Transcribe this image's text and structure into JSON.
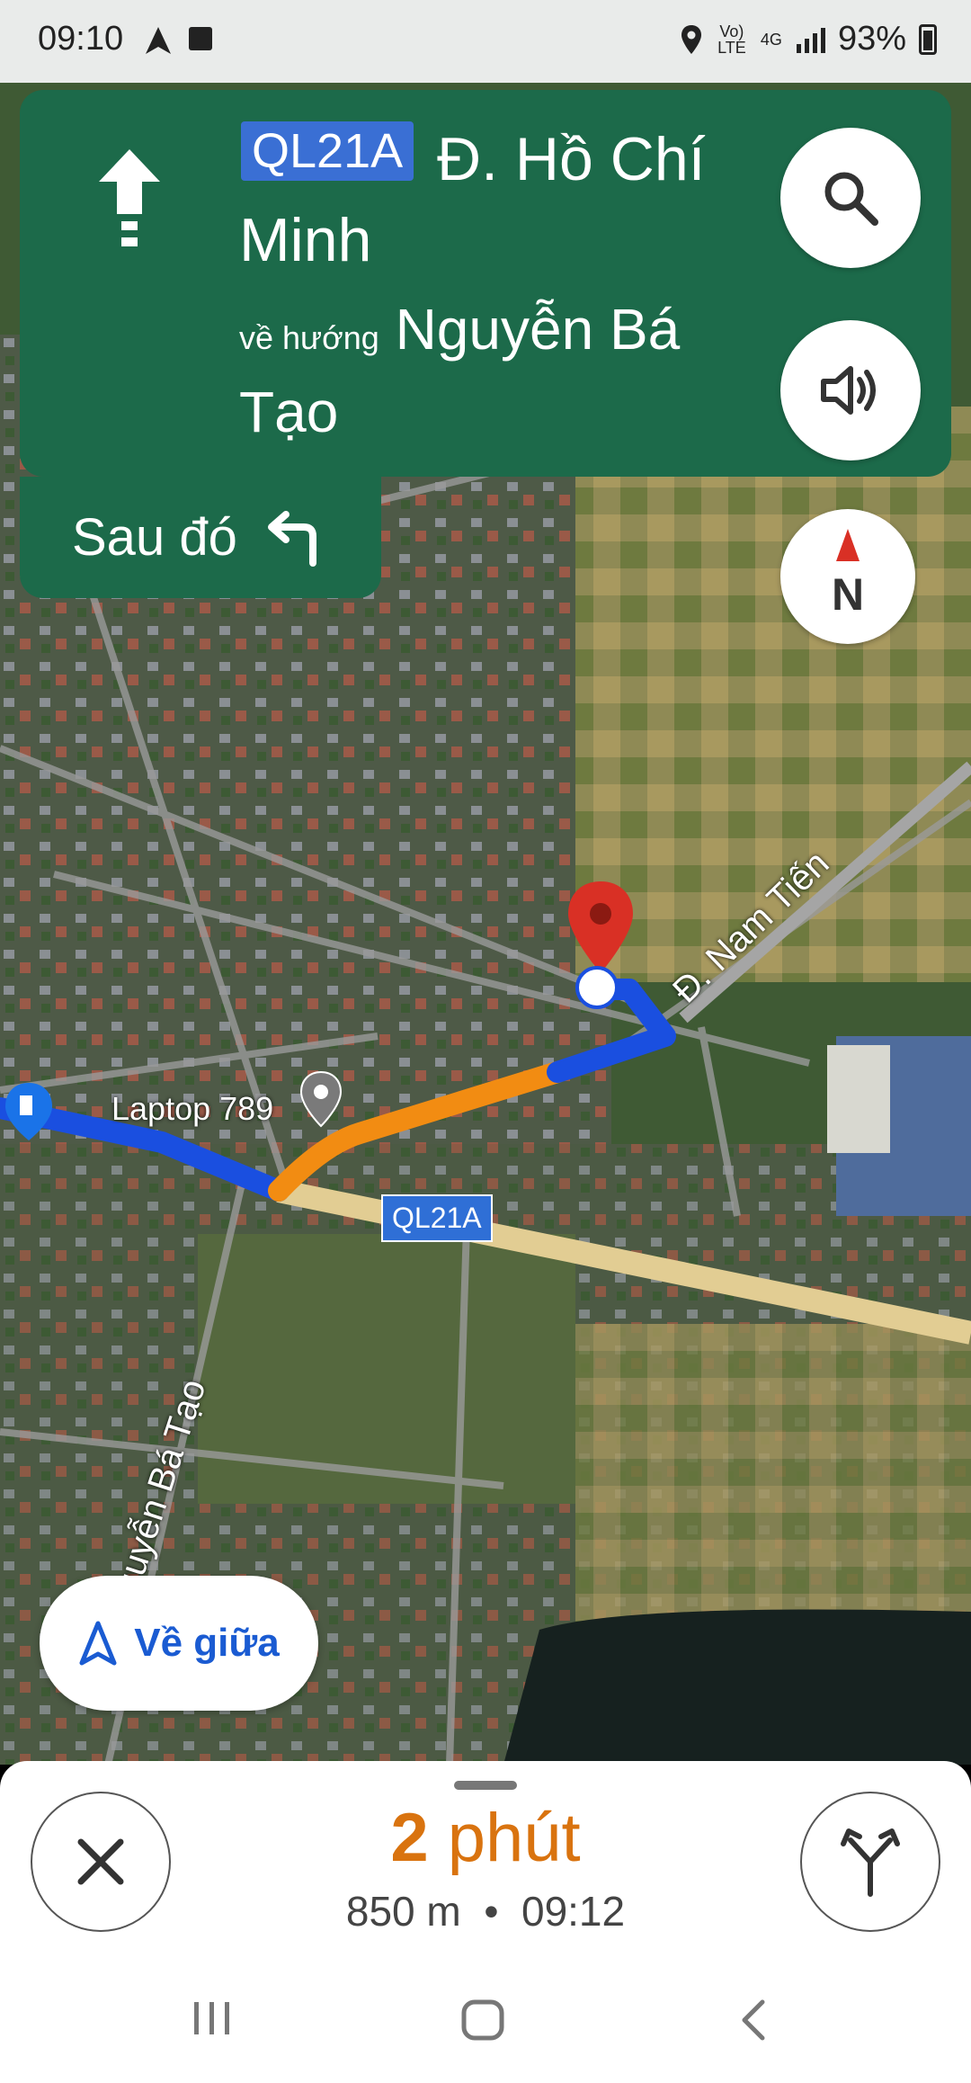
{
  "status_bar": {
    "time": "09:10",
    "network_volte": "Vo) LTE",
    "network_4g": "4G",
    "battery": "93%"
  },
  "navigation": {
    "route_badge": "QL21A",
    "street_name": "Đ. Hồ Chí Minh",
    "toward_prefix": "về hướng",
    "toward_destination": "Nguyễn Bá Tạo",
    "then_label": "Sau đó",
    "header_color": "#1c6a4a"
  },
  "map": {
    "road_label_nam_tien": "Đ. Nam Tiến",
    "road_label_nguyen_ba_tao": "Nguyễn Bá Tạo",
    "road_badge": "QL21A",
    "place_label": "Laptop 789",
    "route_color": "#1a4fe0",
    "traffic_color": "#f28c12",
    "destination_pin_color": "#d93025"
  },
  "compass": {
    "label": "N"
  },
  "recenter": {
    "label": "Về giữa"
  },
  "trip": {
    "duration_value": "2",
    "duration_unit": "phút",
    "distance": "850 m",
    "separator": "•",
    "arrival_time": "09:12",
    "eta_color": "#d9730f"
  }
}
